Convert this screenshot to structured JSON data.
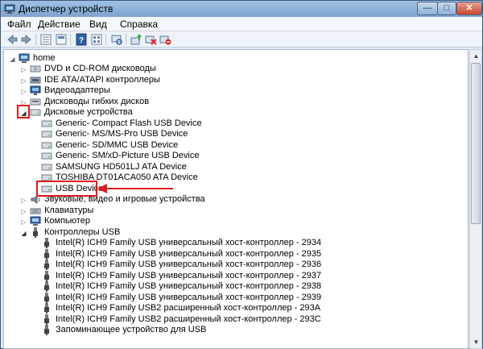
{
  "window": {
    "title": "Диспетчер устройств",
    "min_glyph": "—",
    "max_glyph": "□",
    "close_glyph": "✕"
  },
  "menu": [
    "Файл",
    "Действие",
    "Вид",
    "Справка"
  ],
  "toolbar_icons": [
    "back-icon",
    "forward-icon",
    "properties-list-icon",
    "show-hidden-icon",
    "help-icon",
    "view-icon",
    "scan-hardware-icon",
    "update-driver-icon",
    "disable-device-icon",
    "uninstall-device-icon"
  ],
  "tree": {
    "root": "home",
    "categories": {
      "dvd": "DVD и CD-ROM дисководы",
      "ide": "IDE ATA/ATAPI контроллеры",
      "video": "Видеоадаптеры",
      "floppy": "Дисководы гибких дисков",
      "disks": "Дисковые устройства",
      "sound": "Звуковые, видео и игровые устройства",
      "keyboards": "Клавиатуры",
      "computer": "Компьютер",
      "usb": "Контроллеры USB"
    },
    "disk_devices": [
      "Generic- Compact Flash USB Device",
      "Generic- MS/MS-Pro USB Device",
      "Generic- SD/MMC USB Device",
      "Generic- SM/xD-Picture USB Device",
      "SAMSUNG HD501LJ ATA Device",
      "TOSHIBA DT01ACA050 ATA Device",
      "USB Device"
    ],
    "usb_devices": [
      "Intel(R) ICH9 Family USB универсальный хост-контроллер  - 2934",
      "Intel(R) ICH9 Family USB универсальный хост-контроллер  - 2935",
      "Intel(R) ICH9 Family USB универсальный хост-контроллер  - 2936",
      "Intel(R) ICH9 Family USB универсальный хост-контроллер  - 2937",
      "Intel(R) ICH9 Family USB универсальный хост-контроллер  - 2938",
      "Intel(R) ICH9 Family USB универсальный хост-контроллер  - 2939",
      "Intel(R) ICH9 Family USB2 расширенный хост-контроллер  - 293A",
      "Intel(R) ICH9 Family USB2 расширенный хост-контроллер  - 293C",
      "Запоминающее устройство для USB"
    ]
  },
  "colors": {
    "annotation_red": "#e01b22",
    "selection": "#cce4f7"
  }
}
